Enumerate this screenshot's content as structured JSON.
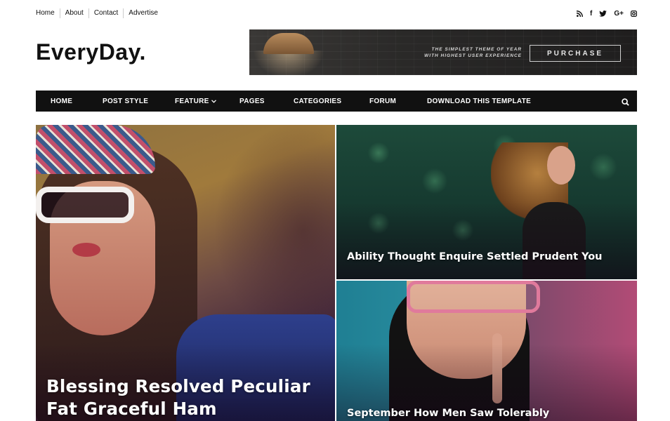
{
  "top_links": [
    "Home",
    "About",
    "Contact",
    "Advertise"
  ],
  "social_icons": [
    "rss-icon",
    "facebook-icon",
    "twitter-icon",
    "google-plus-icon",
    "instagram-icon"
  ],
  "social_labels": {
    "facebook": "f",
    "googleplus": "G+"
  },
  "logo": "EveryDay.",
  "banner": {
    "tagline_line1": "THE SIMPLEST THEME OF YEAR",
    "tagline_line2": "WITH HIGHEST USER EXPERIENCE",
    "button": "PURCHASE"
  },
  "nav": {
    "items": [
      "HOME",
      "POST STYLE",
      "FEATURE",
      "PAGES",
      "CATEGORIES",
      "FORUM",
      "DOWNLOAD THIS TEMPLATE"
    ],
    "search_icon": "search-icon"
  },
  "posts": [
    {
      "title": "Blessing Resolved Peculiar Fat Graceful Ham"
    },
    {
      "title": "Ability Thought Enquire Settled Prudent You"
    },
    {
      "title": "September How Men Saw Tolerably"
    }
  ],
  "colors": {
    "nav_bg": "#111111",
    "text": "#111111",
    "banner_bg": "#2a2928"
  }
}
